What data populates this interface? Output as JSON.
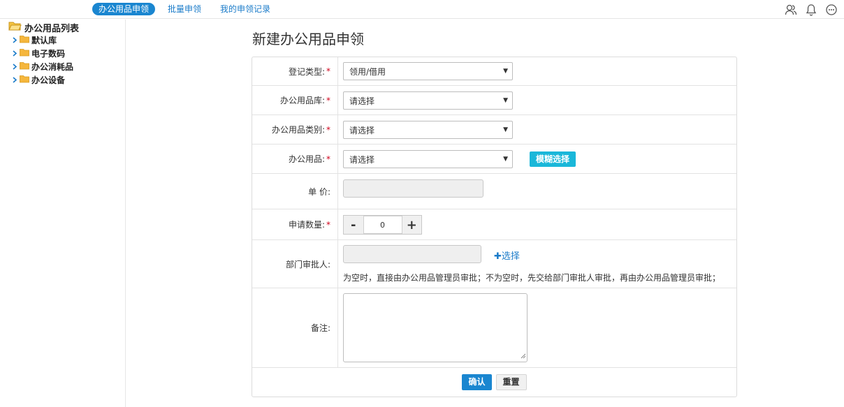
{
  "tabs": [
    {
      "label": "办公用品申领",
      "active": true
    },
    {
      "label": "批量申领",
      "active": false
    },
    {
      "label": "我的申领记录",
      "active": false
    }
  ],
  "top_icons": [
    "contacts-icon",
    "bell-icon",
    "chat-icon"
  ],
  "tree": {
    "root": "办公用品列表",
    "items": [
      "默认库",
      "电子数码",
      "办公消耗品",
      "办公设备"
    ]
  },
  "page_title": "新建办公用品申领",
  "form": {
    "reg_type": {
      "label": "登记类型:",
      "value": "领用/借用"
    },
    "warehouse": {
      "label": "办公用品库:",
      "value": "请选择"
    },
    "category": {
      "label": "办公用品类别:",
      "value": "请选择"
    },
    "item": {
      "label": "办公用品:",
      "value": "请选择",
      "fuzzy_button": "模糊选择"
    },
    "price": {
      "label": "单 价:"
    },
    "quantity": {
      "label": "申请数量:",
      "value": "0",
      "minus": "-",
      "plus": "+"
    },
    "approver": {
      "label": "部门审批人:",
      "select_link": "✚选择",
      "hint": "为空时，直接由办公用品管理员审批；不为空时，先交给部门审批人审批，再由办公用品管理员审批；"
    },
    "remark": {
      "label": "备注:"
    },
    "required_mark": "*"
  },
  "actions": {
    "confirm": "确认",
    "reset": "重置"
  },
  "colors": {
    "accent": "#1a86d0",
    "fuzzy": "#1ab7d9",
    "required": "#d0021b",
    "folder": "#f5b63c"
  }
}
